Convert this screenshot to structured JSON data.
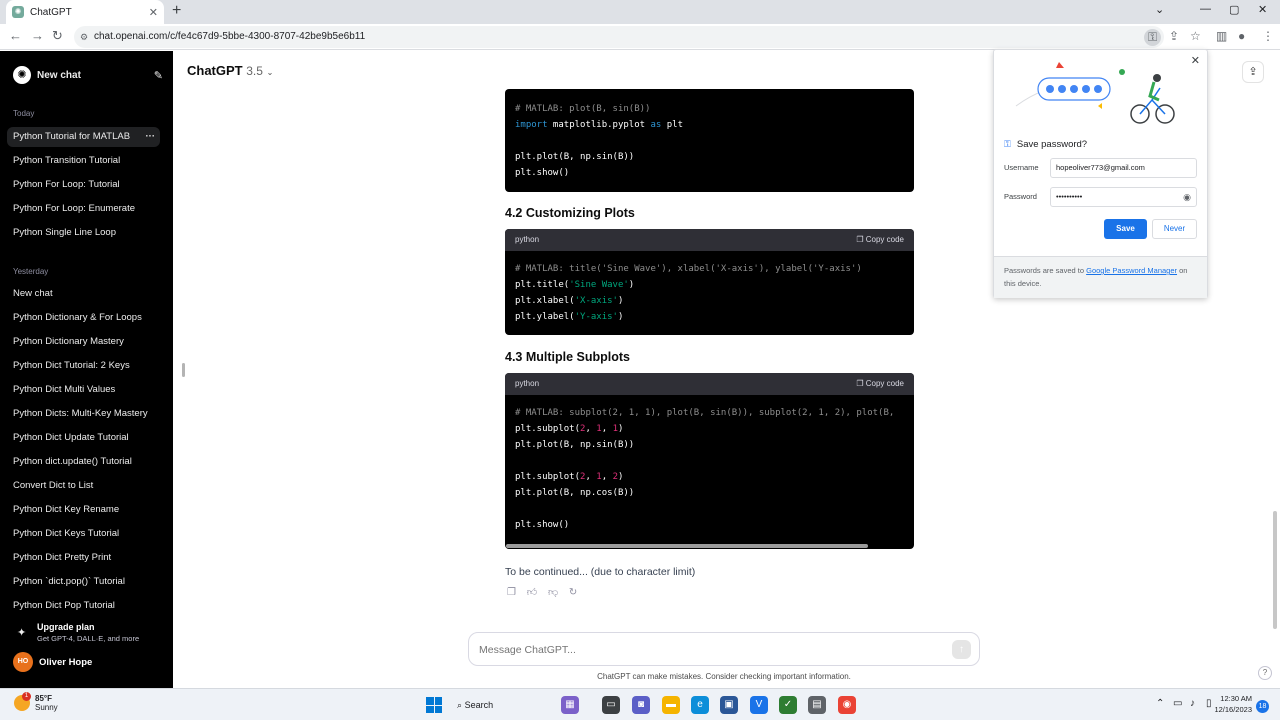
{
  "browser": {
    "tab_title": "ChatGPT",
    "new_tab_label": "+",
    "url": "chat.openai.com/c/fe4c67d9-5bbe-4300-8707-42be9b5e6b11"
  },
  "sidebar": {
    "new_chat_label": "New chat",
    "sections": {
      "today": "Today",
      "yesterday": "Yesterday"
    },
    "today_items": [
      "Python Tutorial for MATLAB",
      "Python Transition Tutorial",
      "Python For Loop: Tutorial",
      "Python For Loop: Enumerate",
      "Python Single Line Loop"
    ],
    "yesterday_items": [
      "New chat",
      "Python Dictionary & For Loops",
      "Python Dictionary Mastery",
      "Python Dict Tutorial: 2 Keys",
      "Python Dict Multi Values",
      "Python Dicts: Multi-Key Mastery",
      "Python Dict Update Tutorial",
      "Python dict.update() Tutorial",
      "Convert Dict to List",
      "Python Dict Key Rename",
      "Python Dict Keys Tutorial",
      "Python Dict Pretty Print",
      "Python `dict.pop()` Tutorial",
      "Python Dict Pop Tutorial"
    ],
    "upgrade": {
      "title": "Upgrade plan",
      "subtitle": "Get GPT-4, DALL·E, and more"
    },
    "user": {
      "initials": "HO",
      "name": "Oliver Hope"
    }
  },
  "main": {
    "model_name": "ChatGPT",
    "model_version": "3.5",
    "headings": {
      "customizing": "4.2 Customizing Plots",
      "subplots": "4.3 Multiple Subplots"
    },
    "code_blocks": [
      {
        "language": "python",
        "copy_label": "Copy code"
      },
      {
        "language": "python",
        "copy_label": "Copy code"
      }
    ],
    "continued_text": "To be continued... (due to character limit)",
    "message_placeholder": "Message ChatGPT...",
    "disclaimer": "ChatGPT can make mistakes. Consider checking important information.",
    "help_label": "?"
  },
  "password_popup": {
    "title": "Save password?",
    "username_label": "Username",
    "username_value": "hopeoliver773@gmail.com",
    "password_label": "Password",
    "password_value": "••••••••••",
    "save_label": "Save",
    "never_label": "Never",
    "footer_prefix": "Passwords are saved to ",
    "footer_link": "Google Password Manager",
    "footer_suffix": " on this device."
  },
  "taskbar": {
    "temperature": "85°F",
    "condition": "Sunny",
    "weather_badge": "1",
    "search_label": "Search",
    "time": "12:30 AM",
    "date": "12/16/2023",
    "notification_count": "18"
  },
  "colors": {
    "sidebar_bg": "#000000",
    "save_button": "#1a73e8",
    "code_bg": "#000000",
    "code_header": "#2f2f36"
  }
}
